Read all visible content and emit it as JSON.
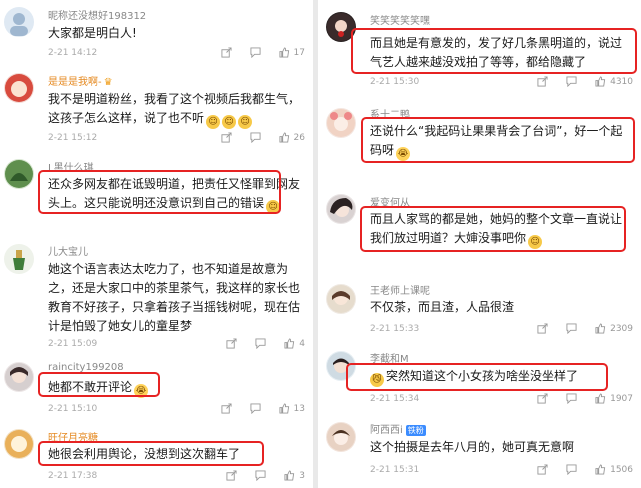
{
  "left": {
    "comments": [
      {
        "user": "昵称还没想好198312",
        "text": "大家都是明白人!",
        "time": "2-21 14:12",
        "likes": "17"
      },
      {
        "user": "是是是我啊-",
        "text": "我不是明道粉丝，我看了这个视频后我都生气，这孩子怎么这样，说了也不听",
        "time": "2-21 15:12",
        "likes": "26"
      },
      {
        "user": "L黑什么琪",
        "text": "还众多网友都在诋毁明道，把责任又怪罪到网友头上。这只能说明还没意识到自己的错误",
        "time": "",
        "likes": ""
      },
      {
        "user": "儿大宝儿",
        "text": "她这个语言表达太吃力了，也不知道是故意为之，还是大家口中的茶里茶气，我这样的家长也教育不好孩子，只拿着孩子当摇钱树呢，现在估计是怕毁了她女儿的童星梦",
        "time": "2-21 15:09",
        "likes": "4"
      },
      {
        "user": "raincity199208",
        "text": "她都不敢开评论",
        "time": "2-21 15:10",
        "likes": "13"
      },
      {
        "user": "旺仔月亮糖",
        "text": "她很会利用舆论，没想到这次翻车了",
        "time": "2-21 17:38",
        "likes": "3"
      }
    ]
  },
  "right": {
    "comments": [
      {
        "user": "笑笑笑笑笑嘿",
        "text": "而且她是有意发的，发了好几条黑明道的，说过气艺人越来越没戏拍了等等，都给隐藏了",
        "time": "2-21 15:30",
        "likes": "4310"
      },
      {
        "user": "系十二鸭",
        "text": "还说什么“我起码让果果背会了台词”，好一个起码呀",
        "time": "",
        "likes": ""
      },
      {
        "user": "爱变何从",
        "text": "而且人家骂的都是她，她妈的整个文章一直说让我们放过明道？大婶没事吧你",
        "time": "",
        "likes": ""
      },
      {
        "user": "王老师上课呢",
        "text": "不仅茶，而且渣，人品很渣",
        "time": "2-21 15:33",
        "likes": "2309"
      },
      {
        "user": "李截和M",
        "text": "突然知道这个小女孩为啥坐没坐样了",
        "time": "2-21 15:34",
        "likes": "1907"
      },
      {
        "user": "阿西西i",
        "badge": "铁粉",
        "text": "这个拍摄是去年八月的，她可真无意啊",
        "time": "2-21 15:31",
        "likes": "1506"
      }
    ]
  },
  "icons": {
    "share": "share-icon",
    "comment": "comment-icon",
    "like": "thumb-up-icon"
  },
  "colors": {
    "highlight_box": "#e62323",
    "username": "#888888",
    "gold_username": "#e58a22"
  }
}
